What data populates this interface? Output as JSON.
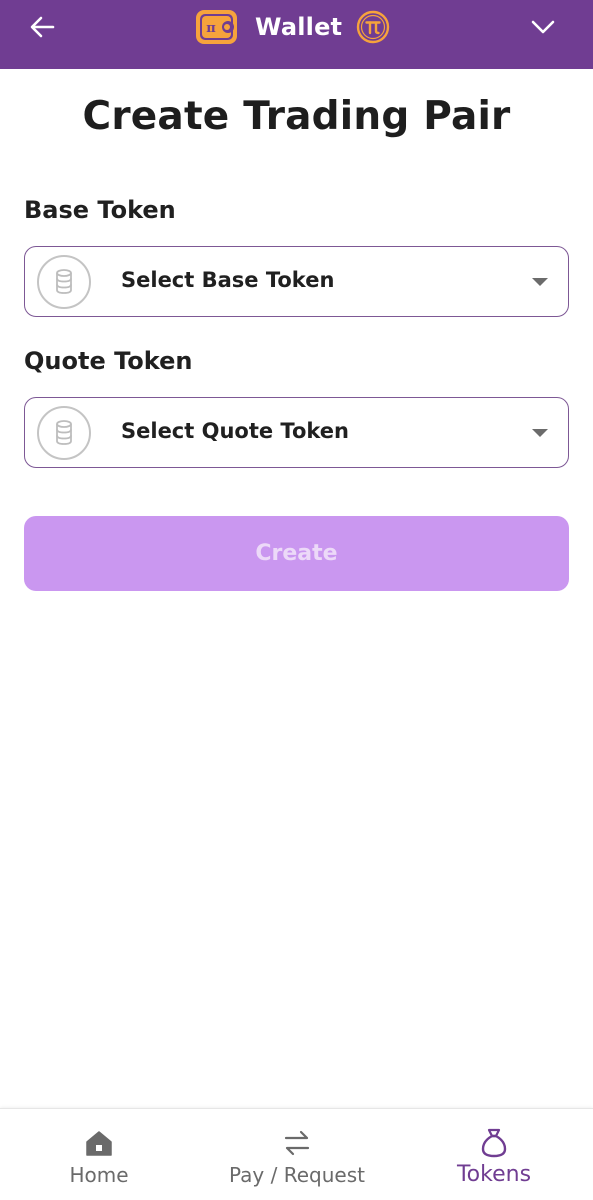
{
  "header": {
    "title": "Wallet",
    "back_icon": "arrow-left-icon",
    "wallet_logo_icon": "wallet-icon",
    "pi_logo_icon": "pi-coin-icon",
    "menu_icon": "chevron-down-icon"
  },
  "page": {
    "title": "Create Trading Pair"
  },
  "base_token": {
    "label": "Base Token",
    "placeholder": "Select Base Token"
  },
  "quote_token": {
    "label": "Quote Token",
    "placeholder": "Select Quote Token"
  },
  "create_button": {
    "label": "Create",
    "enabled": false
  },
  "bottom_nav": {
    "items": [
      {
        "label": "Home",
        "icon": "home-icon",
        "active": false
      },
      {
        "label": "Pay / Request",
        "icon": "swap-arrows-icon",
        "active": false
      },
      {
        "label": "Tokens",
        "icon": "money-bag-icon",
        "active": true
      }
    ]
  },
  "colors": {
    "header_bg": "#703d92",
    "accent_orange": "#f6a33c",
    "create_button_bg": "#ca97f0",
    "active_nav": "#703d92"
  }
}
